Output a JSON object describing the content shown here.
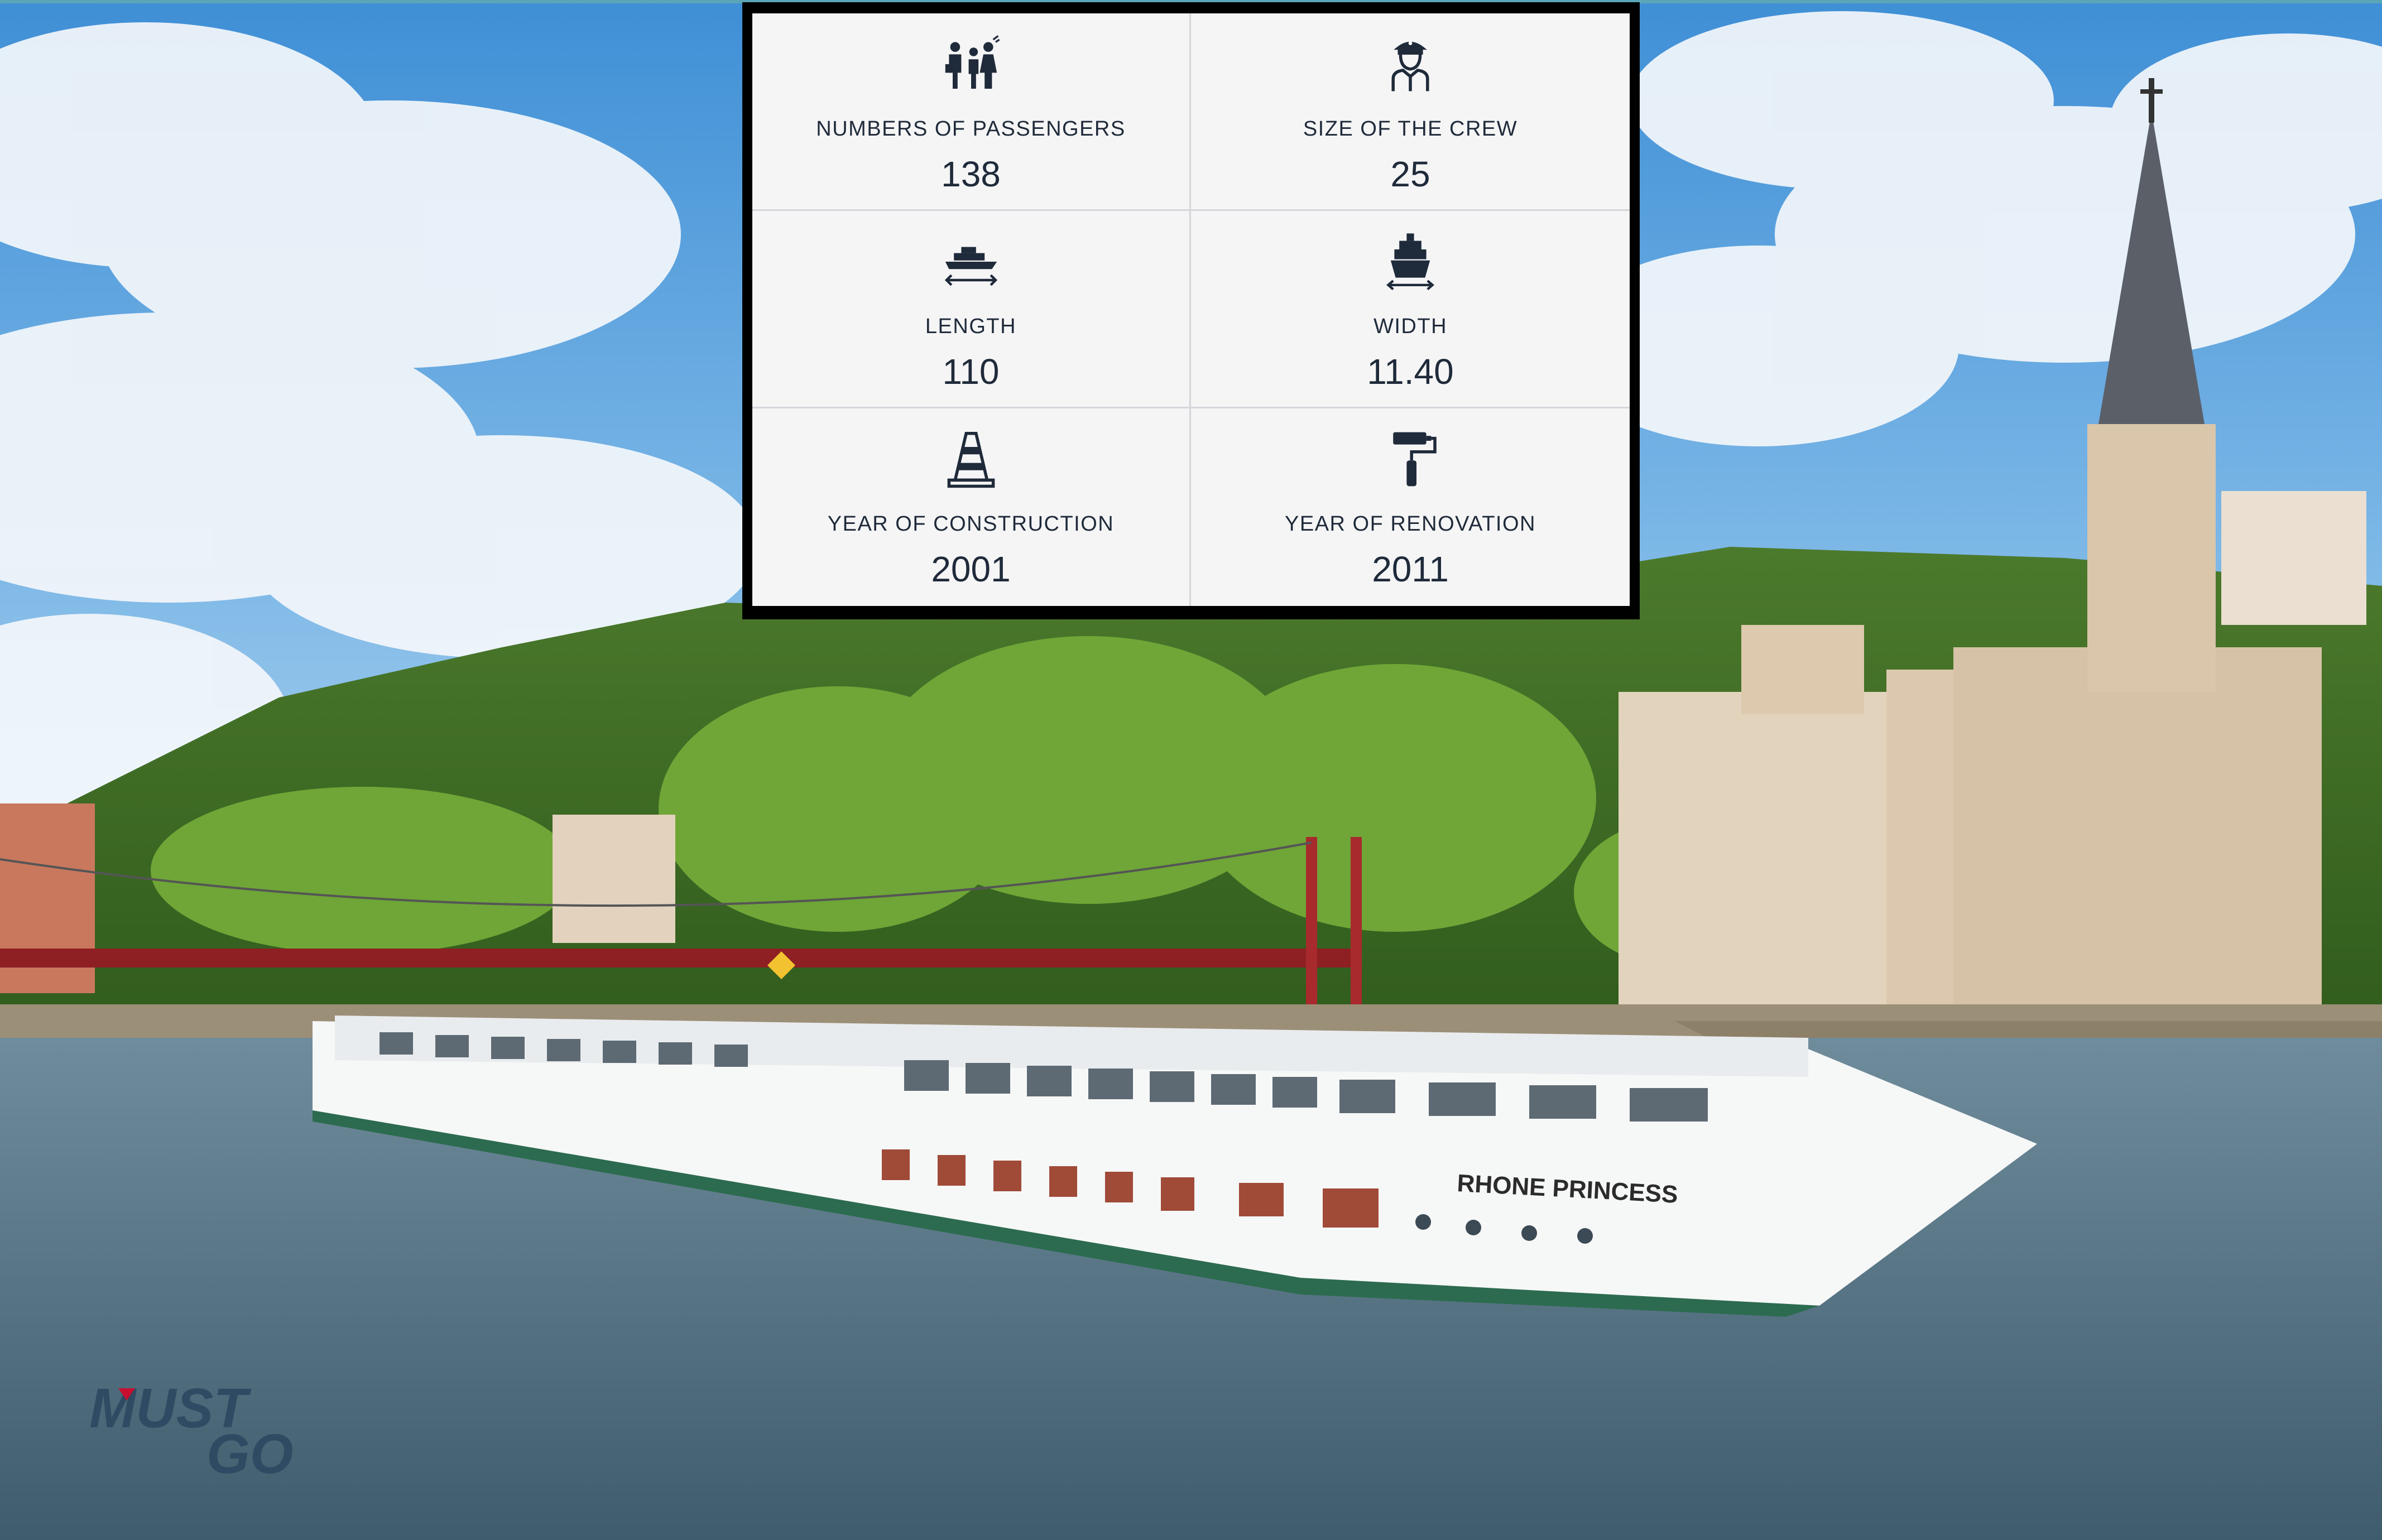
{
  "specs": [
    {
      "icon": "passengers-icon",
      "label": "NUMBERS OF PASSENGERS",
      "value": "138"
    },
    {
      "icon": "crew-icon",
      "label": "SIZE OF THE CREW",
      "value": "25"
    },
    {
      "icon": "length-icon",
      "label": "LENGTH",
      "value": "110"
    },
    {
      "icon": "width-icon",
      "label": "WIDTH",
      "value": "11.40"
    },
    {
      "icon": "construction-cone-icon",
      "label": "YEAR OF CONSTRUCTION",
      "value": "2001"
    },
    {
      "icon": "paint-roller-icon",
      "label": "YEAR OF RENOVATION",
      "value": "2011"
    }
  ],
  "ship_name": "RHONE PRINCESS",
  "logo": {
    "line1": "MUST",
    "line2": "GO"
  },
  "colors": {
    "panel_bg": "#f5f5f6",
    "panel_border": "#000000",
    "text": "#1f2a3a",
    "icon": "#1f2a3a",
    "logo_blue": "#2f4a63",
    "logo_red": "#c8102e"
  }
}
